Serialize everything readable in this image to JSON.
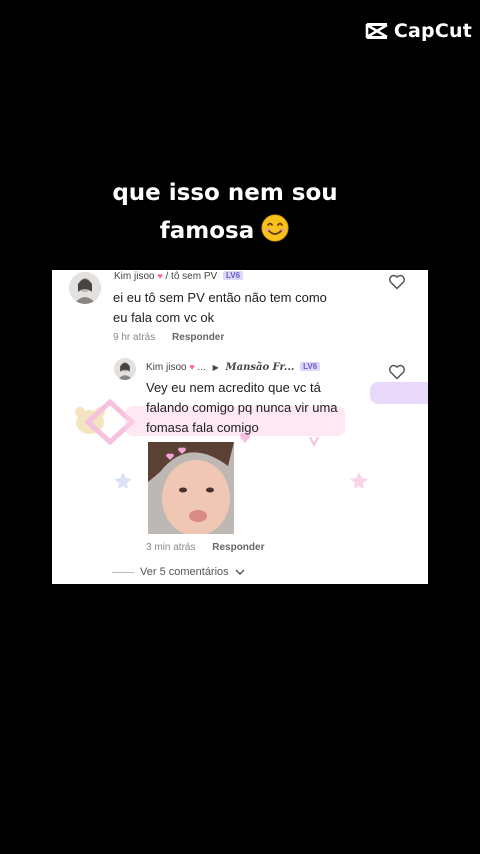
{
  "watermark": {
    "text": "CapCut"
  },
  "caption": {
    "line1": "que isso nem sou",
    "line2": "famosa"
  },
  "comment": {
    "username": "Kim jisoo",
    "tag": "/ tô sem PV",
    "level": "LV6",
    "text_line1": "ei eu tô sem PV então não tem como",
    "text_line2": "eu fala com vc ok",
    "time": "9 hr atrás",
    "reply_label": "Responder"
  },
  "reply": {
    "username": "Kim jisoo",
    "ellipsis": "...",
    "target": "Mansão Fr...",
    "level": "LV6",
    "text_line1": "Vey eu nem acredito que vc tá",
    "text_line2": "falando comigo pq nunca vir uma",
    "text_line3": "fomasa fala comigo",
    "time": "3 min atrás",
    "reply_label": "Responder"
  },
  "footer": {
    "more_label": "Ver 5 comentários"
  },
  "colors": {
    "background": "#000000",
    "card": "#ffffff",
    "badge": "#6a5acd",
    "sticker": "#f3a6d2"
  },
  "icons": [
    "capcut-logo-icon",
    "smiling-emoji-icon",
    "heart-outline-icon",
    "chevron-down-icon",
    "play-arrow-icon"
  ]
}
